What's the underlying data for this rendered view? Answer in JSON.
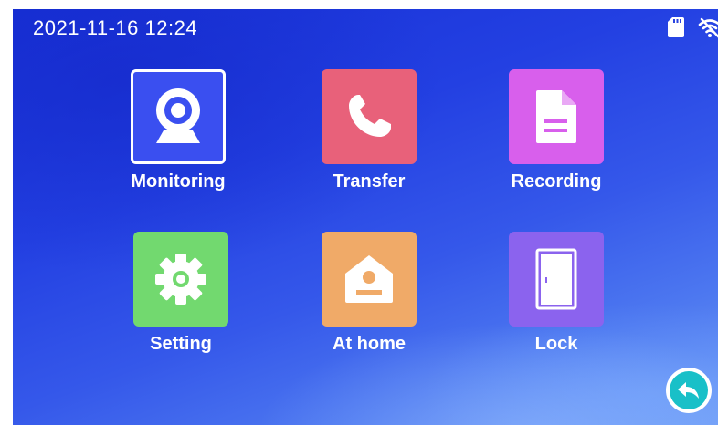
{
  "status_bar": {
    "datetime": "2021-11-16  12:24",
    "icons": [
      "sd-card-icon",
      "wifi-off-icon"
    ]
  },
  "apps": [
    {
      "label": "Monitoring",
      "icon": "camera-icon",
      "color": "#3a4ff0",
      "selected": true
    },
    {
      "label": "Transfer",
      "icon": "phone-icon",
      "color": "#e8617a",
      "selected": false
    },
    {
      "label": "Recording",
      "icon": "document-icon",
      "color": "#d85fec",
      "selected": false
    },
    {
      "label": "Setting",
      "icon": "gear-icon",
      "color": "#72d96f",
      "selected": false
    },
    {
      "label": "At home",
      "icon": "house-icon",
      "color": "#f0aa68",
      "selected": false
    },
    {
      "label": "Lock",
      "icon": "door-icon",
      "color": "#8b63ee",
      "selected": false
    }
  ],
  "back_button": {
    "icon": "back-arrow-icon",
    "color": "#19c0c8"
  }
}
